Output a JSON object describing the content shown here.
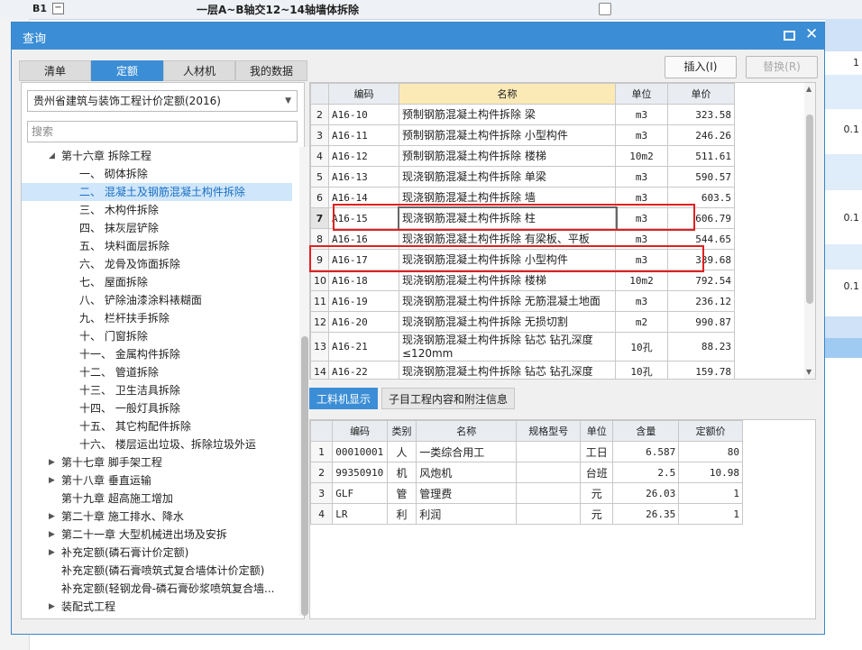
{
  "background": {
    "row_id": "B1",
    "row_title": "一层A~B轴交12~14轴墙体拆除",
    "right_values": [
      "1",
      "0.1",
      "0.1",
      "0.1"
    ]
  },
  "dialog": {
    "title": "查询",
    "tabs": [
      "清单",
      "定额",
      "人材机",
      "我的数据"
    ],
    "active_tab": "定额",
    "insert_button": "插入(I)",
    "replace_button": "替换(R)",
    "quota_select": "贵州省建筑与装饰工程计价定额(2016)",
    "search_placeholder": "搜索"
  },
  "tree": [
    {
      "label": "第十六章 拆除工程",
      "level": 0,
      "toggle": "expanded"
    },
    {
      "label": "一、 砌体拆除",
      "level": 1
    },
    {
      "label": "二、 混凝土及钢筋混凝土构件拆除",
      "level": 1,
      "selected": true
    },
    {
      "label": "三、 木构件拆除",
      "level": 1
    },
    {
      "label": "四、 抹灰层铲除",
      "level": 1
    },
    {
      "label": "五、 块料面层拆除",
      "level": 1
    },
    {
      "label": "六、 龙骨及饰面拆除",
      "level": 1
    },
    {
      "label": "七、 屋面拆除",
      "level": 1
    },
    {
      "label": "八、 铲除油漆涂料裱糊面",
      "level": 1
    },
    {
      "label": "九、 栏杆扶手拆除",
      "level": 1
    },
    {
      "label": "十、 门窗拆除",
      "level": 1
    },
    {
      "label": "十一、 金属构件拆除",
      "level": 1
    },
    {
      "label": "十二、 管道拆除",
      "level": 1
    },
    {
      "label": "十三、 卫生洁具拆除",
      "level": 1
    },
    {
      "label": "十四、 一般灯具拆除",
      "level": 1
    },
    {
      "label": "十五、 其它构配件拆除",
      "level": 1
    },
    {
      "label": "十六、 楼层运出垃圾、拆除垃圾外运",
      "level": 1
    },
    {
      "label": "第十七章 脚手架工程",
      "level": 0,
      "toggle": "collapsed"
    },
    {
      "label": "第十八章 垂直运输",
      "level": 0,
      "toggle": "collapsed"
    },
    {
      "label": "第十九章 超高施工增加",
      "level": 0
    },
    {
      "label": "第二十章 施工排水、降水",
      "level": 0,
      "toggle": "collapsed"
    },
    {
      "label": "第二十一章 大型机械进出场及安拆",
      "level": 0,
      "toggle": "collapsed"
    },
    {
      "label": "补充定额(磷石膏计价定额)",
      "level": 0,
      "toggle": "collapsed"
    },
    {
      "label": "补充定额(磷石膏喷筑式复合墙体计价定额)",
      "level": 0
    },
    {
      "label": "补充定额(轻钢龙骨-磷石膏砂浆喷筑复合墙...",
      "level": 0
    },
    {
      "label": "装配式工程",
      "level": 0,
      "toggle": "collapsed"
    }
  ],
  "quota_table": {
    "headers": [
      "编码",
      "名称",
      "单位",
      "单价"
    ],
    "rows": [
      {
        "no": "2",
        "code": "A16-10",
        "name": "预制钢筋混凝土构件拆除 梁",
        "unit": "m3",
        "price": "323.58"
      },
      {
        "no": "3",
        "code": "A16-11",
        "name": "预制钢筋混凝土构件拆除 小型构件",
        "unit": "m3",
        "price": "246.26"
      },
      {
        "no": "4",
        "code": "A16-12",
        "name": "预制钢筋混凝土构件拆除 楼梯",
        "unit": "10m2",
        "price": "511.61"
      },
      {
        "no": "5",
        "code": "A16-13",
        "name": "现浇钢筋混凝土构件拆除 单梁",
        "unit": "m3",
        "price": "590.57"
      },
      {
        "no": "6",
        "code": "A16-14",
        "name": "现浇钢筋混凝土构件拆除 墙",
        "unit": "m3",
        "price": "603.5"
      },
      {
        "no": "7",
        "code": "A16-15",
        "name": "现浇钢筋混凝土构件拆除 柱",
        "unit": "m3",
        "price": "606.79",
        "current": true
      },
      {
        "no": "8",
        "code": "A16-16",
        "name": "现浇钢筋混凝土构件拆除 有梁板、平板",
        "unit": "m3",
        "price": "544.65"
      },
      {
        "no": "9",
        "code": "A16-17",
        "name": "现浇钢筋混凝土构件拆除 小型构件",
        "unit": "m3",
        "price": "339.68"
      },
      {
        "no": "10",
        "code": "A16-18",
        "name": "现浇钢筋混凝土构件拆除 楼梯",
        "unit": "10m2",
        "price": "792.54"
      },
      {
        "no": "11",
        "code": "A16-19",
        "name": "现浇钢筋混凝土构件拆除 无筋混凝土地面",
        "unit": "m3",
        "price": "236.12"
      },
      {
        "no": "12",
        "code": "A16-20",
        "name": "现浇钢筋混凝土构件拆除 无损切割",
        "unit": "m2",
        "price": "990.87"
      },
      {
        "no": "13",
        "code": "A16-21",
        "name": "现浇钢筋混凝土构件拆除 钻芯 钻孔深度≤120mm",
        "unit": "10孔",
        "price": "88.23"
      },
      {
        "no": "14",
        "code": "A16-22",
        "name": "现浇钢筋混凝土构件拆除 钻芯 钻孔深度",
        "unit": "10孔",
        "price": "159.78"
      }
    ]
  },
  "bottom_tabs": [
    "工料机显示",
    "子目工程内容和附注信息"
  ],
  "resource_table": {
    "headers": [
      "编码",
      "类别",
      "名称",
      "规格型号",
      "单位",
      "含量",
      "定额价"
    ],
    "rows": [
      {
        "no": "1",
        "code": "00010001",
        "type": "人",
        "name": "一类综合用工",
        "spec": "",
        "unit": "工日",
        "qty": "6.587",
        "price": "80"
      },
      {
        "no": "2",
        "code": "99350910",
        "type": "机",
        "name": "风炮机",
        "spec": "",
        "unit": "台班",
        "qty": "2.5",
        "price": "10.98"
      },
      {
        "no": "3",
        "code": "GLF",
        "type": "管",
        "name": "管理费",
        "spec": "",
        "unit": "元",
        "qty": "26.03",
        "price": "1"
      },
      {
        "no": "4",
        "code": "LR",
        "type": "利",
        "name": "利润",
        "spec": "",
        "unit": "元",
        "qty": "26.35",
        "price": "1"
      }
    ]
  }
}
